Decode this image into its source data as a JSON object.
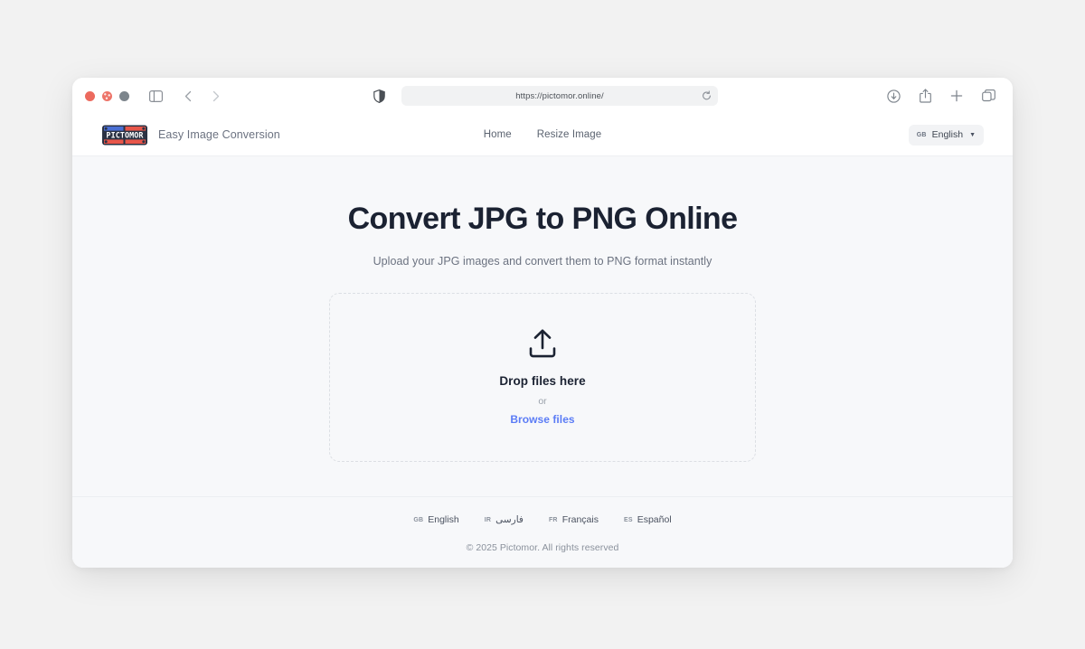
{
  "browser": {
    "traffic_lights": [
      "close",
      "minimize",
      "maximize"
    ],
    "url": "https://pictomor.online/",
    "toolbar_icons_left": [
      "sidebar-icon",
      "back-icon",
      "forward-icon"
    ],
    "toolbar_icons_right": [
      "downloads-icon",
      "share-icon",
      "new-tab-icon",
      "tab-overview-icon"
    ],
    "address_icons": [
      "shield-icon",
      "reload-icon"
    ]
  },
  "site": {
    "logo_text": "PICTOMOR",
    "tagline": "Easy Image Conversion",
    "nav": [
      {
        "label": "Home"
      },
      {
        "label": "Resize Image"
      }
    ],
    "language_selector": {
      "code": "GB",
      "label": "English",
      "caret": "▼"
    }
  },
  "main": {
    "title": "Convert JPG to PNG Online",
    "subtitle": "Upload your JPG images and convert them to PNG format instantly",
    "dropzone": {
      "icon": "upload-icon",
      "title": "Drop files here",
      "or": "or",
      "browse_label": "Browse files"
    }
  },
  "footer": {
    "languages": [
      {
        "code": "GB",
        "label": "English"
      },
      {
        "code": "IR",
        "label": "فارسی"
      },
      {
        "code": "FR",
        "label": "Français"
      },
      {
        "code": "ES",
        "label": "Español"
      }
    ],
    "copyright": "© 2025 Pictomor. All rights reserved"
  },
  "colors": {
    "accent_link": "#5b7cf6",
    "heading": "#1b2232",
    "page_bg": "#f7f8fa",
    "logo_blue": "#4a6fd4",
    "logo_red": "#e8564a",
    "logo_dark": "#2b3243"
  }
}
